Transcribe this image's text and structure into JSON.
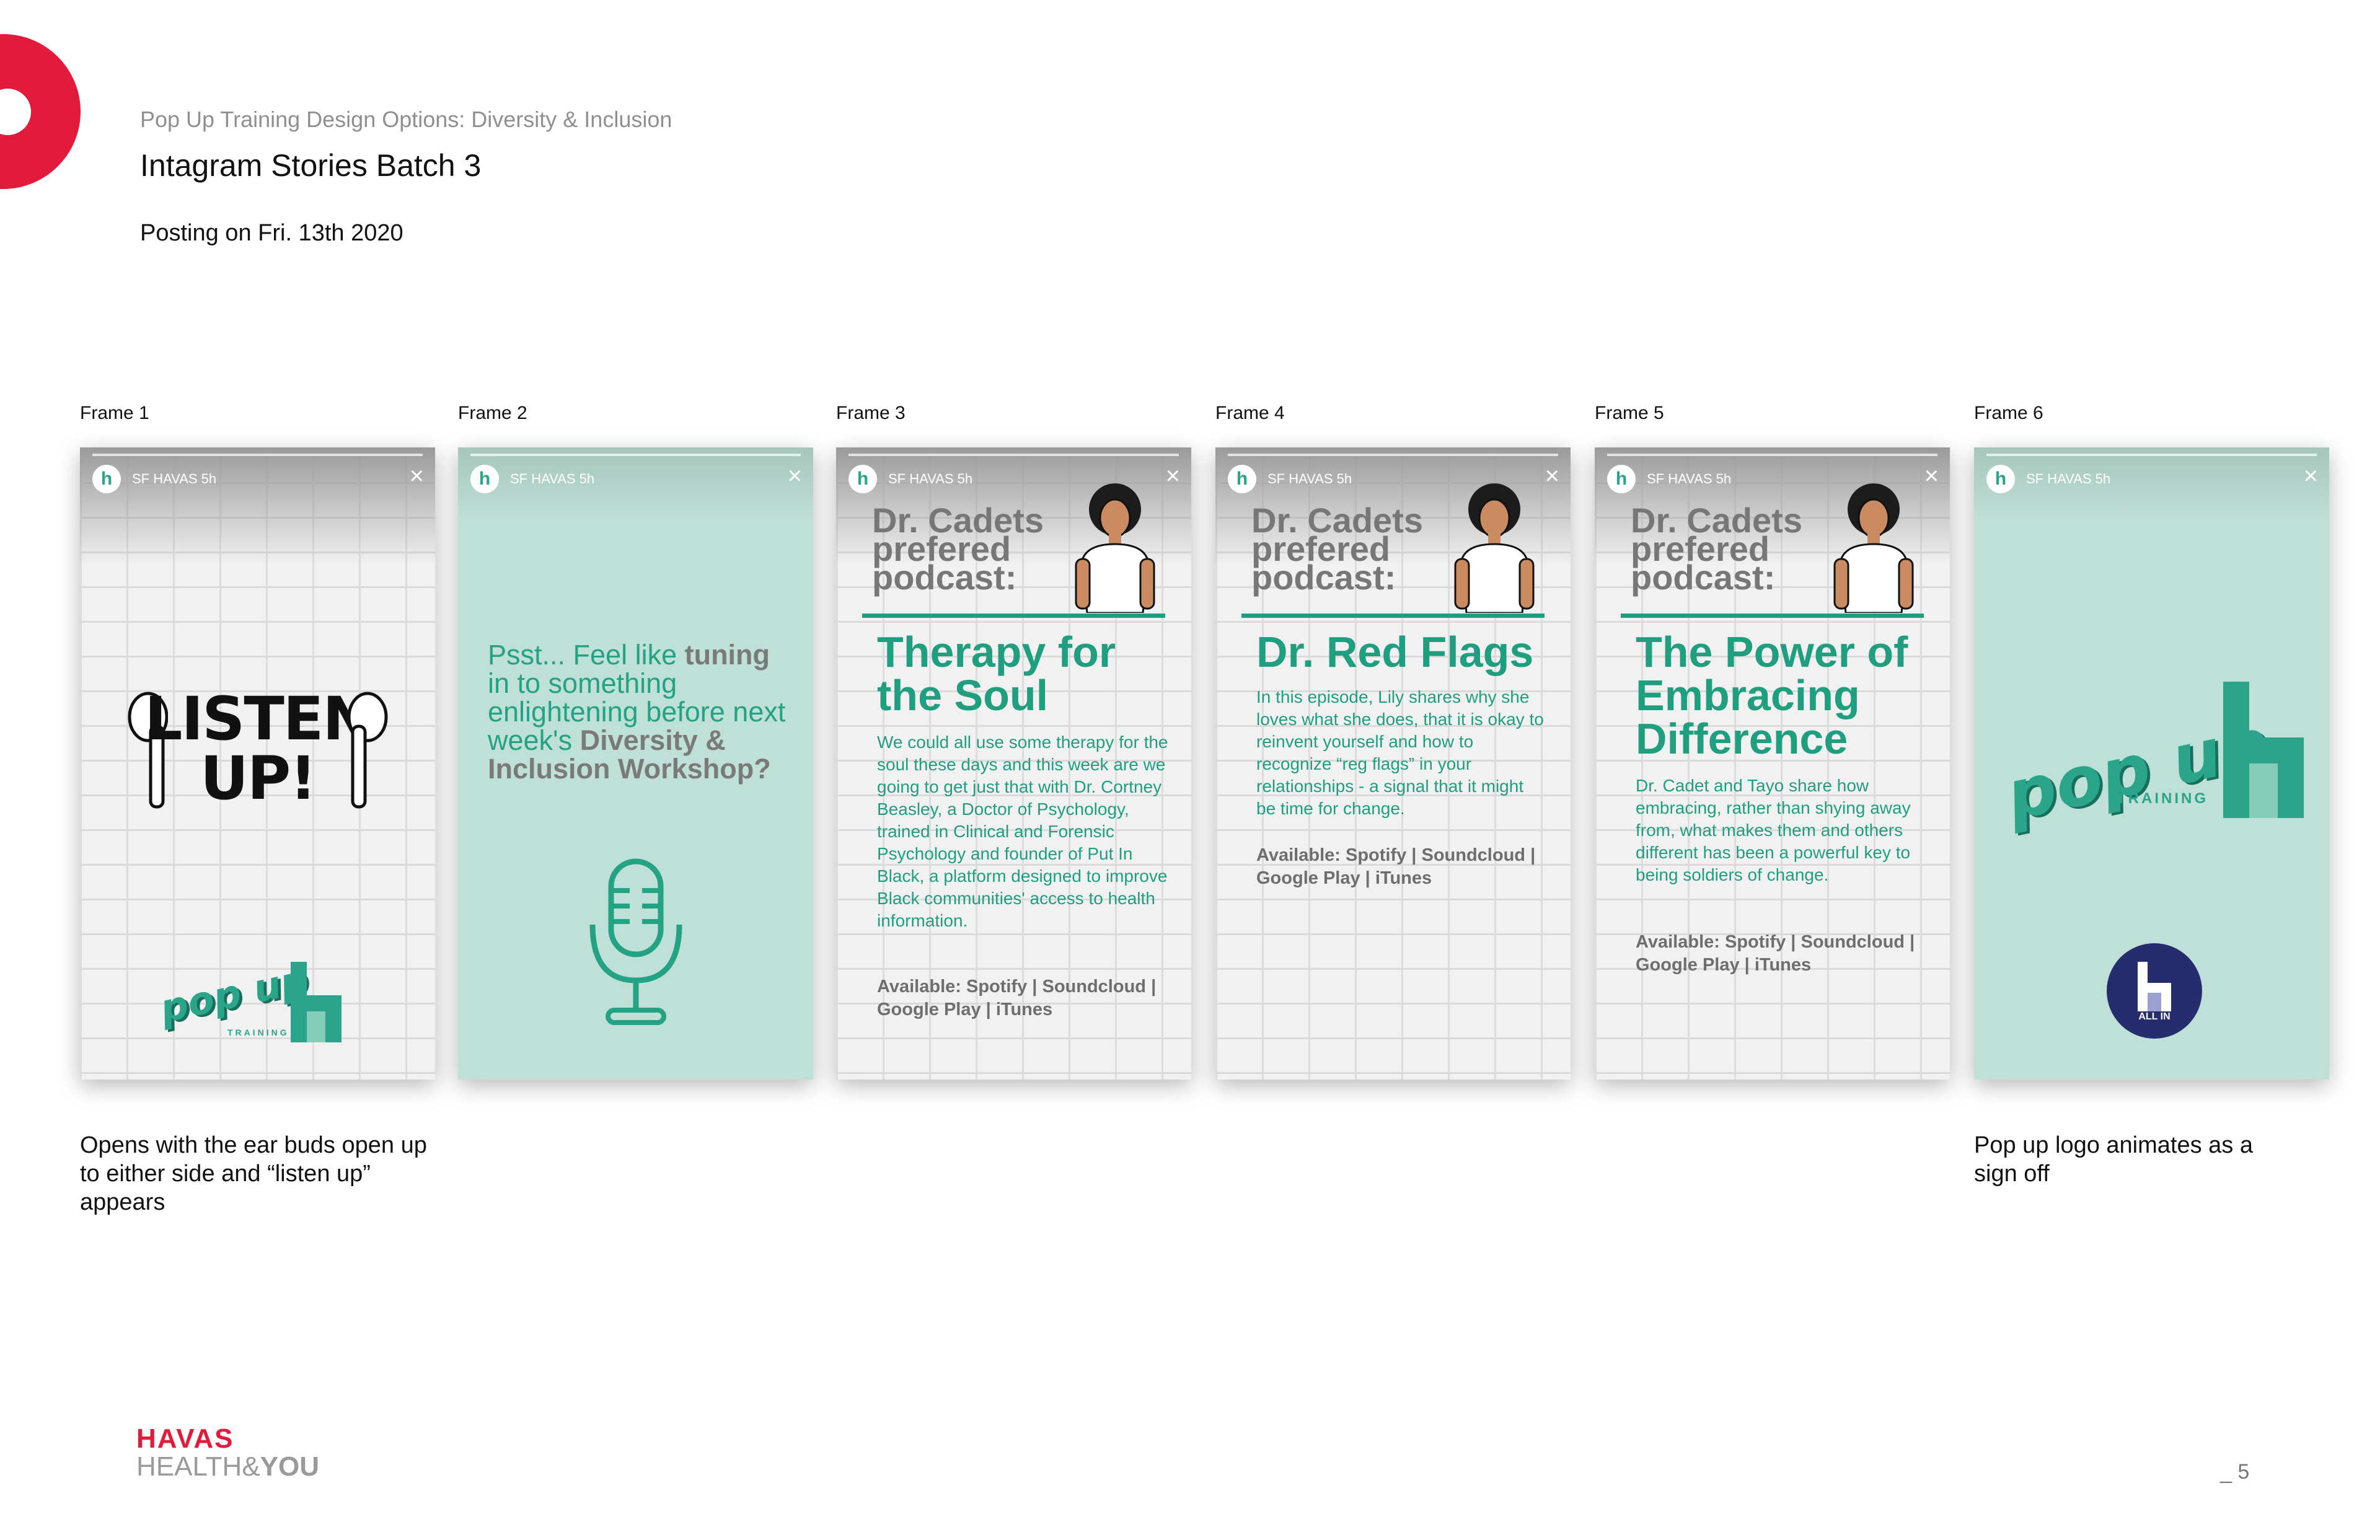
{
  "header": {
    "kicker": "Pop Up Training Design Options: Diversity & Inclusion",
    "title": "Intagram Stories Batch 3",
    "posting": "Posting on Fri. 13th 2020"
  },
  "story_chrome": {
    "user": "SF HAVAS 5h",
    "avatar": "h",
    "close": "×"
  },
  "frames": [
    {
      "label": "Frame 1",
      "listen_text": "LISTEN UP!",
      "logo": "pop up",
      "training": "TRAINING"
    },
    {
      "label": "Frame 2",
      "psst_plain": "Psst... Feel like ",
      "psst_bold1": "tuning",
      "psst_mid": " in to something enlightening before next week's ",
      "psst_bold2": "Diversity & Inclusion Workshop?"
    },
    {
      "label": "Frame 3",
      "header": "Dr. Cadets prefered podcast:",
      "title": "Therapy for the Soul",
      "body": "We could all use some therapy for the soul these days and this week are we going to get just that with Dr. Cortney Beasley, a Doctor of Psychology, trained in Clinical and Forensic Psychology and founder of Put In Black, a platform designed to improve Black communities' access to health information.",
      "available": "Available: Spotify | Soundcloud | Google Play | iTunes"
    },
    {
      "label": "Frame 4",
      "header": "Dr. Cadets prefered podcast:",
      "title": "Dr. Red Flags",
      "body": "In this episode, Lily shares why she loves what she does, that it is okay to reinvent yourself and how to recognize “reg flags” in your relationships - a signal that it might be time for change.",
      "available": "Available: Spotify | Soundcloud | Google Play | iTunes"
    },
    {
      "label": "Frame 5",
      "header": "Dr. Cadets prefered podcast:",
      "title": "The Power of Embracing Difference",
      "body": "Dr. Cadet and Tayo share how embracing, rather than shying away from, what makes them and others different has been a powerful key to being soldiers of change.",
      "available": "Available: Spotify | Soundcloud | Google Play | iTunes"
    },
    {
      "label": "Frame 6",
      "logo": "pop up",
      "training": "TRAINING",
      "allin": "ALL IN"
    }
  ],
  "captions": {
    "frame1": "Opens with the ear buds open up to either side and “listen up” appears",
    "frame6": "Pop up logo animates as a sign off"
  },
  "footer": {
    "brand_top": "HAVAS",
    "brand_bottom_plain": "HEALTH&",
    "brand_bottom_bold": "YOU",
    "page": "_ 5"
  },
  "colors": {
    "accent_red": "#e21b3c",
    "teal": "#1f9e80",
    "mint": "#bfe0d7",
    "navy": "#262d6e"
  },
  "icons": [
    "airpod-icon",
    "microphone-icon",
    "close-icon",
    "havas-h-icon"
  ]
}
